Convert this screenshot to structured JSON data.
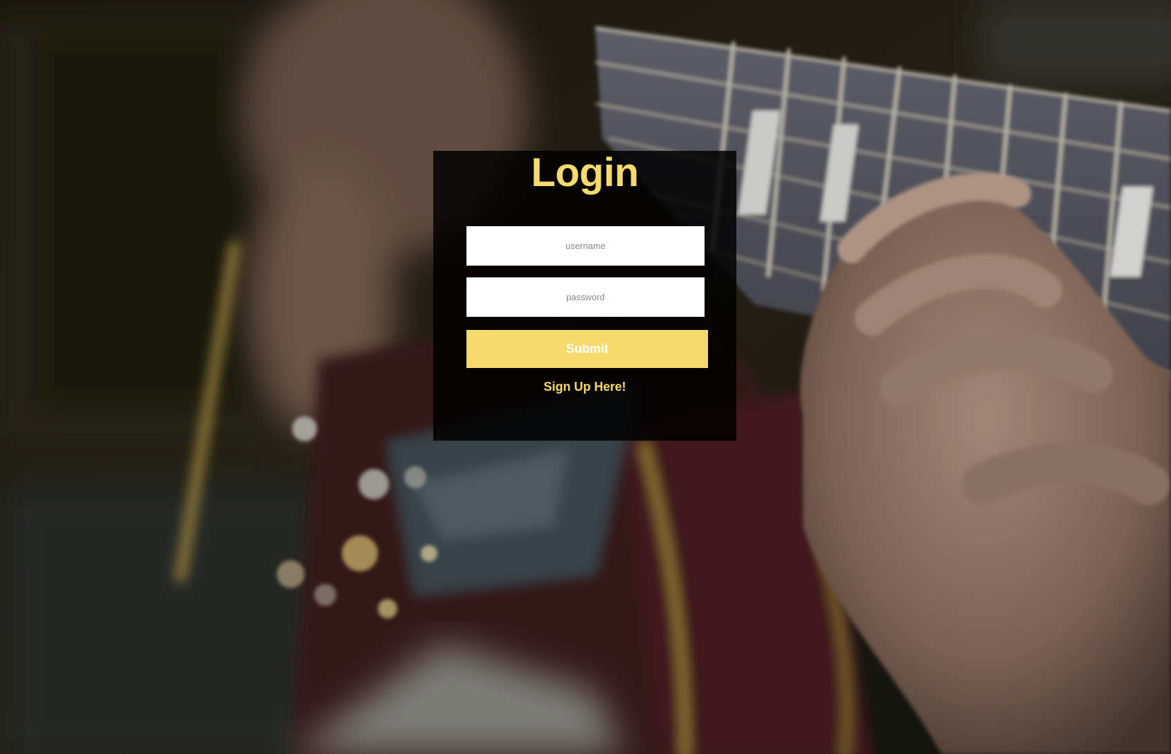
{
  "colors": {
    "accent": "#f6da6b",
    "panel_background": "#000000",
    "field_background": "#ffffff",
    "submit_text": "#ffffff"
  },
  "background": {
    "icon": "guitar-photo-icon"
  },
  "login": {
    "title": "Login",
    "username_placeholder": "username",
    "username_value": "",
    "password_placeholder": "password",
    "password_value": "",
    "submit_label": "Submit",
    "signup_label": "Sign Up Here!"
  }
}
